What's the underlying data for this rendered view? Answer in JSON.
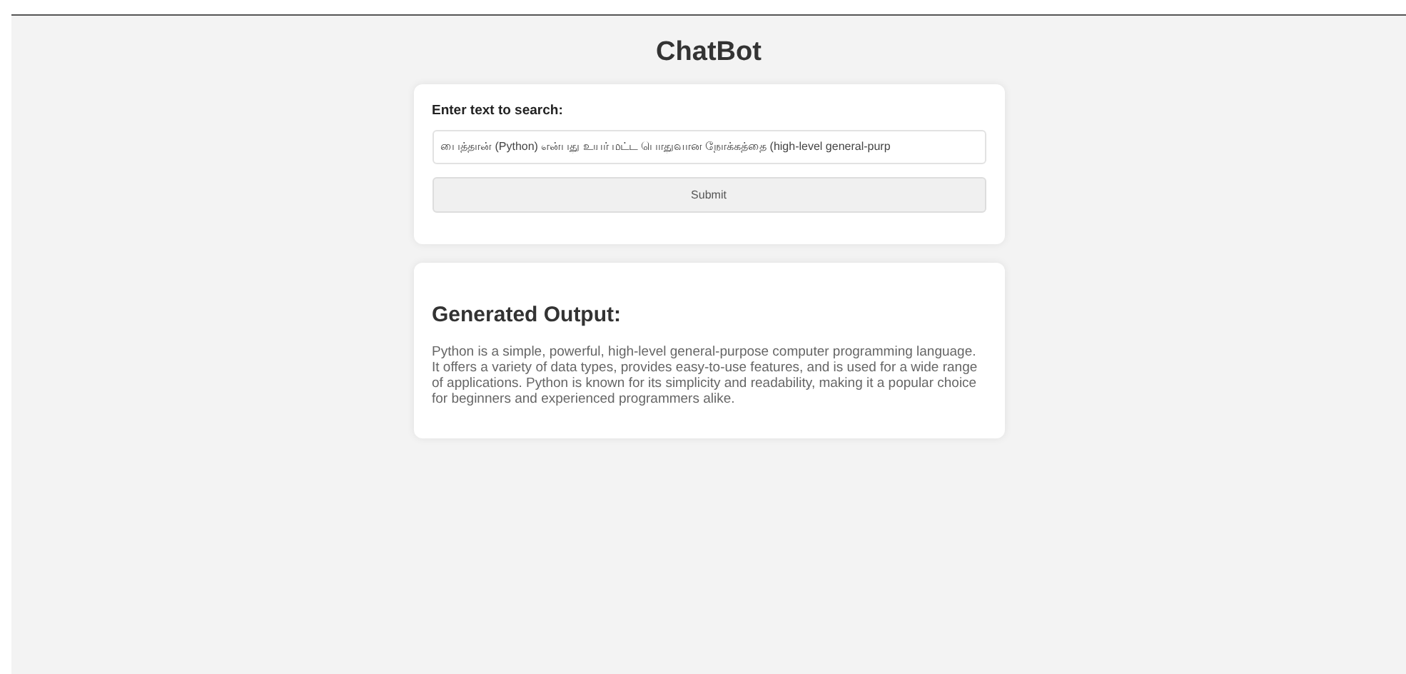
{
  "title": "ChatBot",
  "search_form": {
    "label": "Enter text to search:",
    "input_value": "பைத்தான் (Python) என்பது உயர் மட்ட பொதுவான நோக்கத்தை (high-level general-purp",
    "submit_button": "Submit"
  },
  "output": {
    "heading": "Generated Output:",
    "text": "Python is a simple, powerful, high-level general-purpose computer programming language. It offers a variety of data types, provides easy-to-use features, and is used for a wide range of applications. Python is known for its simplicity and readability, making it a popular choice for beginners and experienced programmers alike."
  }
}
